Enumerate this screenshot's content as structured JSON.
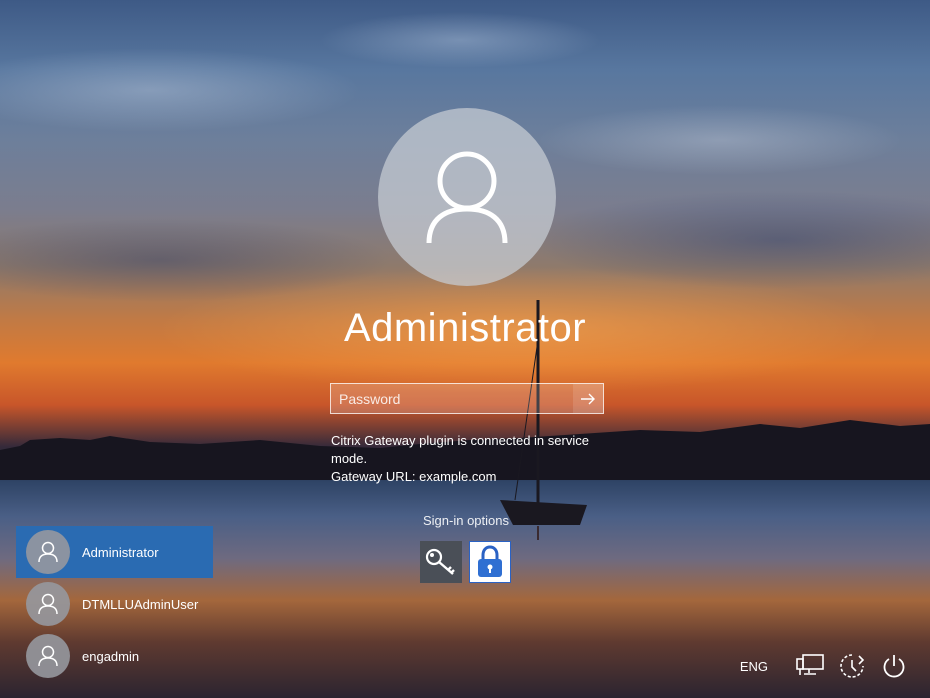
{
  "user": {
    "display_name": "Administrator",
    "password_placeholder": "Password",
    "submit_icon": "arrow-right-icon"
  },
  "message": {
    "line1": "Citrix Gateway plugin is connected in service mode.",
    "line2": "Gateway URL: example.com"
  },
  "sign_in": {
    "label": "Sign-in options",
    "options": [
      {
        "icon": "key-icon"
      },
      {
        "icon": "lock-icon"
      }
    ]
  },
  "users": [
    {
      "name": "Administrator",
      "selected": true
    },
    {
      "name": "DTMLLUAdminUser",
      "selected": false
    },
    {
      "name": "engadmin",
      "selected": false
    }
  ],
  "tray": {
    "language": "ENG",
    "icons": [
      "network-icon",
      "ease-of-access-icon",
      "power-icon"
    ]
  },
  "colors": {
    "selected_user": "#2a6bb2",
    "lock_border": "#2a62c4"
  }
}
